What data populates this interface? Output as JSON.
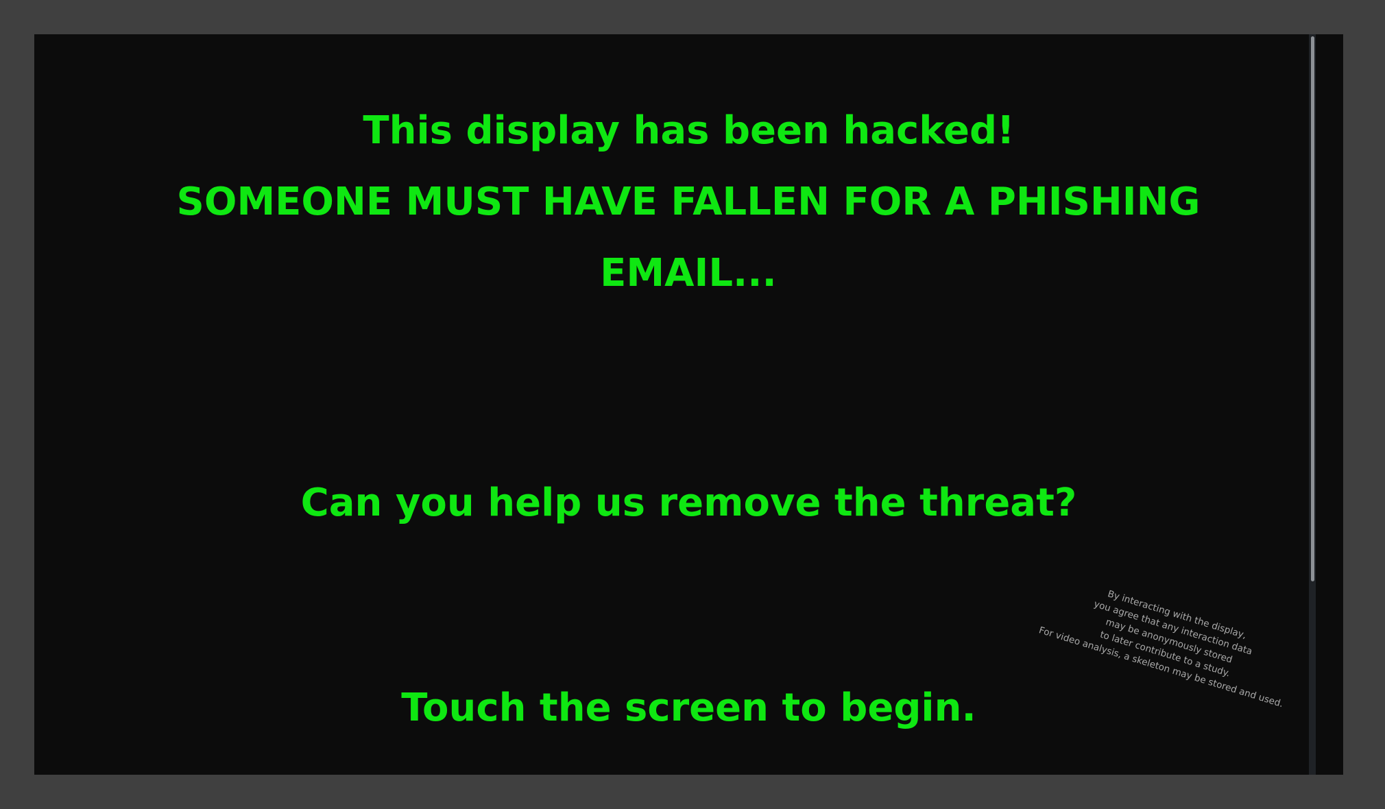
{
  "screen": {
    "headline": "This display has been hacked!",
    "subheadline": "SOMEONE MUST HAVE FALLEN FOR A PHISHING EMAIL...",
    "question": "Can you help us remove the threat?",
    "call_to_action": "Touch the screen to begin.",
    "disclaimer_lines": [
      "By interacting with the display,",
      "you agree that any interaction data",
      "may be anonymously stored",
      "to later contribute to a study.",
      "For video analysis, a skeleton may be stored and used."
    ]
  },
  "colors": {
    "text_accent": "#0fe712",
    "background": "#0c0c0c",
    "frame": "#404040",
    "disclaimer_text": "#a9a9a9"
  }
}
